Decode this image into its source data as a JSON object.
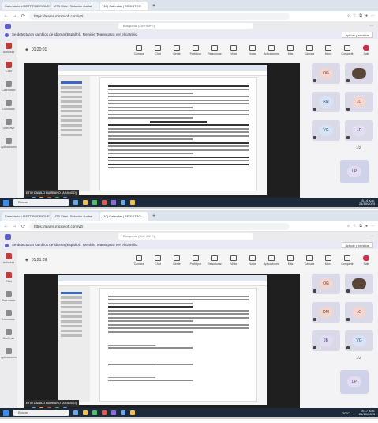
{
  "screens": [
    {
      "tabs": [
        "Calendario LISETT RODRIGUEZ I",
        "UTS Chat | Solución ducha",
        "(10) Calendar | REGISTRO",
        "+"
      ],
      "url": "https://teams.microsoft.com/v2/",
      "search_placeholder": "Búsqueda (Ctrl+Alt+E)",
      "banner": "Se detectaron cambios de idioma (Español). Reinicie Teams para ver el cambio.",
      "banner_button": "Aplicar y reiniciar",
      "timer": "01:20:01",
      "rail": [
        "Actividad",
        "Chat",
        "Calendario",
        "Llamadas",
        "OneDrive",
        "Aplicaciones"
      ],
      "tools": [
        "Cámara",
        "Chat",
        "Gente",
        "Participar",
        "Reaccionar",
        "Vista",
        "Notas",
        "Aplicaciones",
        "Más",
        "Cámara",
        "Micro",
        "Compartir",
        "Salir"
      ],
      "presenter": "ETIO DANILO BURBANO (ARANGO)",
      "doc_title": "FUNDACIÓN NUEVO AMANECER DE COLOMBIA",
      "tiles": [
        "OG",
        "",
        "RN",
        "LO",
        "VG",
        "LR"
      ],
      "pager": "1/2",
      "large_tile": "LP"
    },
    {
      "tabs": [
        "Calendario LISETT RODRIGUEZ I",
        "UTS Chat | Solución ducha",
        "(10) Calendar | REGISTRO",
        "+"
      ],
      "url": "https://teams.microsoft.com/v2/",
      "search_placeholder": "Búsqueda (Ctrl+Alt+E)",
      "banner": "Se detectaron cambios de idioma (Español). Reinicie Teams para ver el cambio.",
      "banner_button": "Aplicar y reiniciar",
      "timer": "01:21:09",
      "rail": [
        "Actividad",
        "Chat",
        "Calendario",
        "Llamadas",
        "OneDrive",
        "Aplicaciones"
      ],
      "tools": [
        "Cámara",
        "Chat",
        "Gente",
        "Participar",
        "Reaccionar",
        "Vista",
        "Notas",
        "Aplicaciones",
        "Más",
        "Cámara",
        "Micro",
        "Compartir",
        "Salir"
      ],
      "presenter": "ETIO DANILO BURBANO (ARANGO)",
      "doc_title": "Firmas",
      "tiles": [
        "OG",
        "",
        "DM",
        "LO",
        "JB",
        "VG"
      ],
      "pager": "1/2",
      "large_tile": "LP"
    }
  ],
  "taskbar": {
    "search_placeholder": "Buscar",
    "time1": "8:14 a.m.",
    "date1": "21/10/2023",
    "time2": "8:17 a.m.",
    "date2": "21/10/2023",
    "temperature": "20°C"
  }
}
